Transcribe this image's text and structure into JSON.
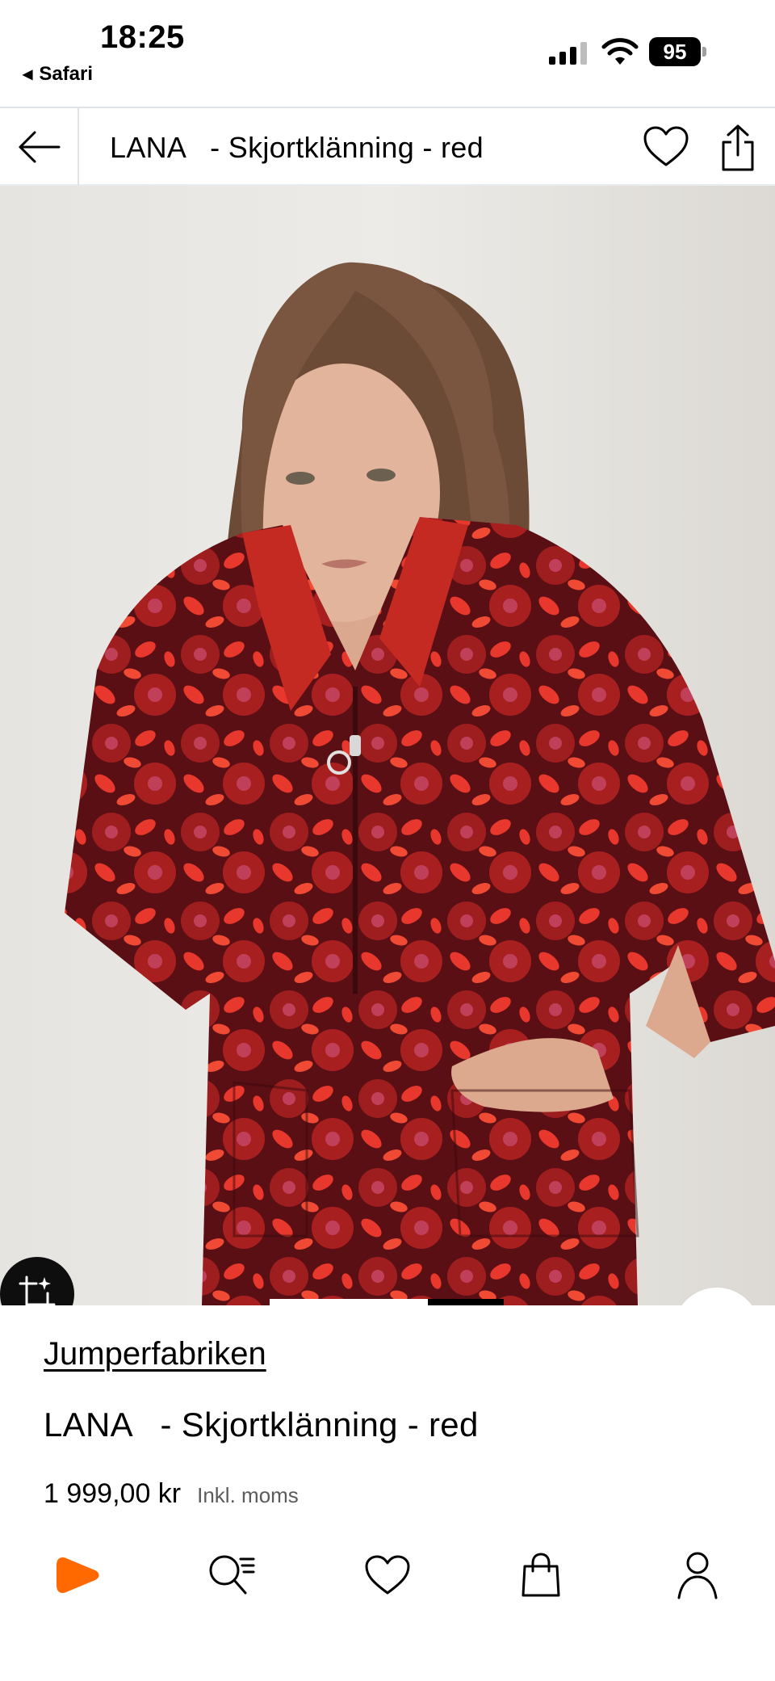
{
  "status_bar": {
    "time": "18:25",
    "back_app": "Safari",
    "battery": "95"
  },
  "header": {
    "title": "LANA   - Skjortklänning - red"
  },
  "product": {
    "brand": "Jumperfabriken",
    "name": "LANA   - Skjortklänning - red",
    "price": "1 999,00 kr",
    "vat_note": "Inkl. moms"
  },
  "colors": {
    "accent": "#ff6900",
    "text": "#000000",
    "muted": "#5b5b5b",
    "dress_red": "#c42a22",
    "dress_dark": "#5a0f14"
  },
  "icons": {
    "header_back": "arrow-left-icon",
    "header_fav": "heart-icon",
    "header_share": "share-icon",
    "image_ai": "ai-crop-icon",
    "image_notify": "bell-icon",
    "image_wish": "heart-icon",
    "nav_home": "home-play-icon",
    "nav_search": "search-list-icon",
    "nav_wishlist": "heart-icon",
    "nav_bag": "shopping-bag-icon",
    "nav_profile": "person-icon"
  }
}
